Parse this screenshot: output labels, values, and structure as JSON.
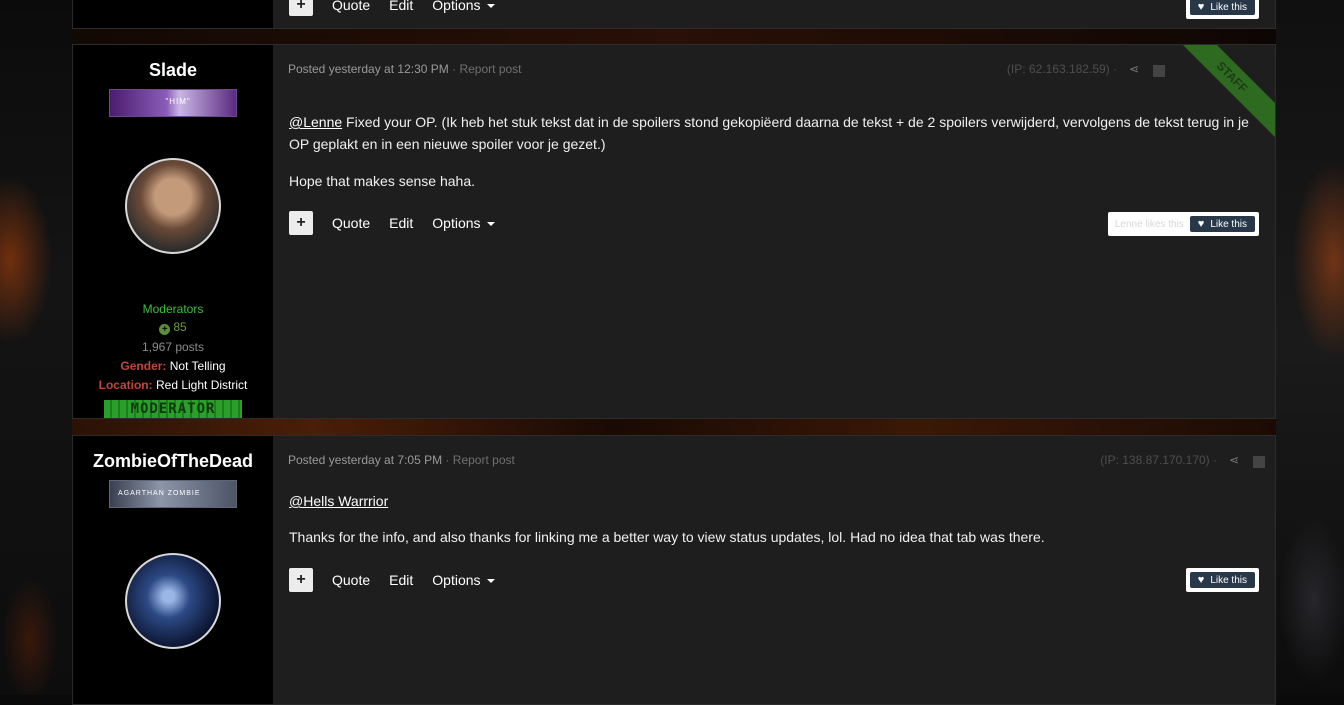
{
  "controls": {
    "plus": "+",
    "quote": "Quote",
    "edit": "Edit",
    "options": "Options",
    "like": "Like this",
    "heart": "♥",
    "share": "⋖"
  },
  "posts": [
    {
      "author": "Slade",
      "rank_tag": "\"HIM\"",
      "group": "Moderators",
      "reputation": "85",
      "post_count": "1,967 posts",
      "gender_label": "Gender:",
      "gender": "Not Telling",
      "location_label": "Location:",
      "location": "Red Light District",
      "mod_badge": "MODERATOR",
      "posted_prefix": "Posted yesterday at",
      "posted_time": "12:30 PM",
      "separator": "·",
      "report": "Report post",
      "ip": "(IP: 62.163.182.59) ·",
      "staff_ribbon": "STAFF",
      "mention": "@Lenne",
      "body_text": " Fixed your OP. (Ik heb het stuk tekst dat in de spoilers stond gekopiëerd daarna de tekst + de 2 spoilers verwijderd, vervolgens de tekst terug in je OP geplakt en in een nieuwe spoiler voor je gezet.)",
      "body_text2": "Hope that makes sense haha.",
      "likers": "Lenne likes this"
    },
    {
      "author": "ZombieOfTheDead",
      "rank_tag": "AGARTHAN ZOMBIE",
      "posted_prefix": "Posted yesterday at",
      "posted_time": "7:05 PM",
      "separator": "·",
      "report": "Report post",
      "ip": "(IP: 138.87.170.170) ·",
      "mention": "@Hells Warrrior",
      "body_text2": "Thanks for the info, and also thanks for linking me a better way to view status updates, lol. Had no idea that tab was there."
    }
  ]
}
